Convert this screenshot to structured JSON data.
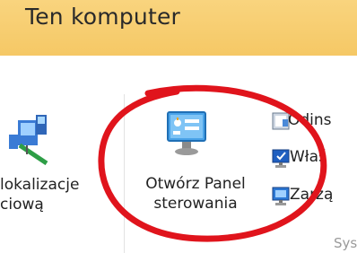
{
  "window": {
    "title": "Ten komputer"
  },
  "ribbon": {
    "network_location": {
      "line1": "lokalizacje",
      "line2": "ciową"
    },
    "open_control_panel": {
      "line1": "Otwórz Panel",
      "line2": "sterowania"
    },
    "small_items": [
      {
        "label": "Odins",
        "icon": "uninstall-programs-icon"
      },
      {
        "label": "Właś",
        "icon": "system-properties-icon"
      },
      {
        "label": "Zarzą",
        "icon": "manage-icon"
      }
    ],
    "group_label": "Sys"
  },
  "annotation": {
    "color": "#e0141c",
    "shape": "ellipse"
  }
}
